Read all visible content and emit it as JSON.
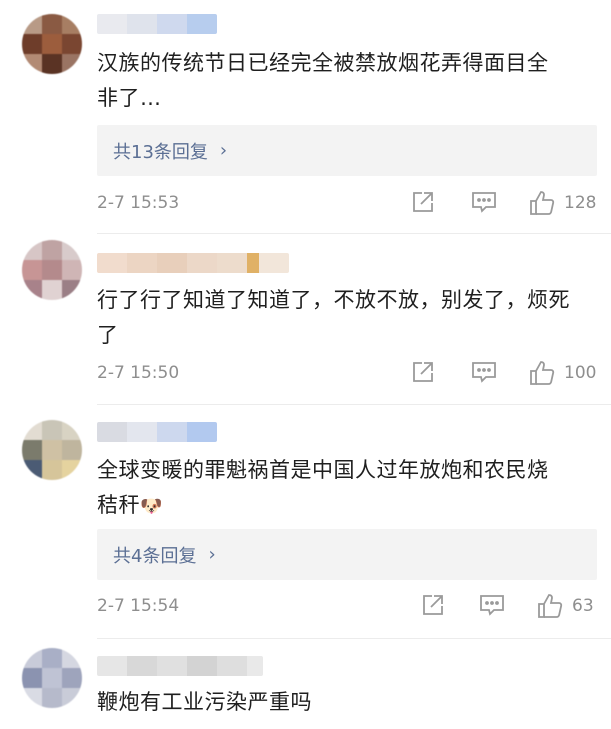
{
  "comments": [
    {
      "text_line1": "汉族的传统节日已经完全被禁放烟花弄得面目全",
      "text_line2": "非了…",
      "replies_label": "共13条回复",
      "time": "2-7 15:53",
      "likes": "128"
    },
    {
      "text_line1": "行了行了知道了知道了，不放不放，别发了，烦死",
      "text_line2": "了",
      "time": "2-7 15:50",
      "likes": "100"
    },
    {
      "text_line1": "全球变暖的罪魁祸首是中国人过年放炮和农民烧",
      "text_line2": "秸秆",
      "emoji": "🐶",
      "replies_label": "共4条回复",
      "time": "2-7 15:54",
      "likes": "63"
    },
    {
      "text_line1": "鞭炮有工业污染严重吗"
    }
  ],
  "icons": {
    "share": "share-icon",
    "comment": "comment-icon",
    "like": "thumbs-up-icon",
    "chevron": "chevron-right-icon"
  },
  "colors": {
    "reply_link": "#5b6f94",
    "reply_bg": "#f3f3f3",
    "meta_gray": "#8e8e8e"
  }
}
